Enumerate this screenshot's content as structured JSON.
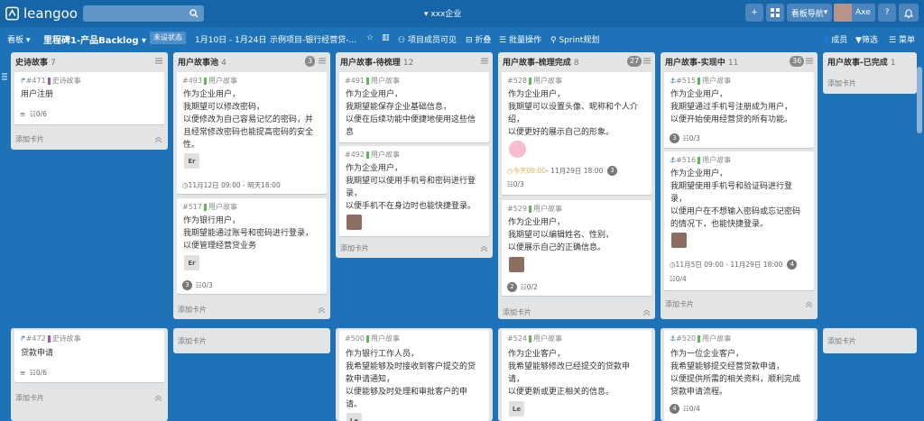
{
  "app": {
    "name": "leangoo"
  },
  "header": {
    "company": "xxx企业",
    "board_nav": "看板导航",
    "user": "Axe",
    "help": "?"
  },
  "subbar": {
    "board": "看板",
    "milestone": "里程碑1-产品Backlog",
    "status": "未设状态",
    "dates": "1月10日 - 1月24日",
    "project": "示例项目-银行经营贷-...",
    "members_visible": "项目成员可见",
    "fold": "折叠",
    "batch": "批量操作",
    "sprint": "Sprint规划",
    "members": "成员",
    "filter": "筛选",
    "menu": "菜单"
  },
  "lists": [
    {
      "title": "史诗故事",
      "count": "7",
      "cards": [
        {
          "id": "#471",
          "type": "史诗故事",
          "lines": [
            "用户注册"
          ],
          "checklist": "0/6"
        },
        {
          "id": "#472",
          "type": "史诗故事",
          "lines": [
            "贷款申请"
          ],
          "checklist": "0/6"
        }
      ],
      "add": "添加卡片"
    },
    {
      "title": "用户故事池",
      "count": "4",
      "badge": "3",
      "cards": [
        {
          "id": "#493",
          "type": "用户故事",
          "lines": [
            "作为企业用户，",
            "我期望可以修改密码，",
            "以便修改为自己容易记忆的密码，并",
            "且经常修改密码也能提高密码的安全",
            "性。"
          ],
          "avatar": "Er",
          "time": "11月12日 09:00 - 明天18:00"
        },
        {
          "id": "#517",
          "type": "用户故事",
          "lines": [
            "作为银行用户，",
            "我期望能通过账号和密码进行登录，",
            "以便管理经营贷业务"
          ],
          "avatar": "Er",
          "comments": "3",
          "checklist": "0/3"
        }
      ],
      "add": "添加卡片",
      "bottom_add": "添加卡片"
    },
    {
      "title": "用户故事-待梳理",
      "count": "12",
      "cards": [
        {
          "id": "#491",
          "type": "用户故事",
          "lines": [
            "作为企业用户，",
            "我期望能保存企业基础信息，",
            "以便在后续功能中便捷地使用这些信",
            "息"
          ]
        },
        {
          "id": "#492",
          "type": "用户故事",
          "lines": [
            "作为企业用户，",
            "我期望可以使用手机号和密码进行登",
            "录，",
            "以便手机不在身边时也能快捷登录。"
          ]
        },
        {
          "id": "#500",
          "type": "用户故事",
          "lines": [
            "作为银行工作人员，",
            "我希望能够及时接收到客户提交的贷",
            "款申请通知，",
            "以便能够及时处理和审批客户的申",
            "请。"
          ],
          "avatar": "Le"
        }
      ],
      "add": "添加卡片"
    },
    {
      "title": "用户故事-梳理完成",
      "count": "8",
      "badge": "27",
      "cards": [
        {
          "id": "#528",
          "type": "用户故事",
          "lines": [
            "作为企业用户，",
            "我期望可以设置头像、昵称和个人介",
            "绍，",
            "以便更好的展示自己的形象。"
          ],
          "time_today": "今天09:00",
          "time_end": " - 11月29日 18:00",
          "comments": "3",
          "checklist": "0/3"
        },
        {
          "id": "#529",
          "type": "用户故事",
          "lines": [
            "作为企业用户，",
            "我期望可以编辑姓名、性别，",
            "以便展示自己的正确信息。"
          ],
          "comments": "2",
          "checklist": "0/2"
        },
        {
          "id": "#524",
          "type": "用户故事",
          "lines": [
            "作为企业客户，",
            "我希望能够修改已经提交的贷款申",
            "请，",
            "以便更新或更正相关的信息。"
          ],
          "avatar": "Le"
        }
      ],
      "add": "添加卡片"
    },
    {
      "title": "用户故事-实现中",
      "count": "11",
      "badge": "36",
      "cards": [
        {
          "id": "#515",
          "type": "用户故事",
          "lines": [
            "作为企业用户，",
            "我期望通过手机号注册成为用户，",
            "以便开始使用经营贷的所有功能。"
          ],
          "comments": "3",
          "checklist": "0/3"
        },
        {
          "id": "#516",
          "type": "用户故事",
          "lines": [
            "作为企业用户，",
            "我期望使用手机号和验证码进行登",
            "录，",
            "以便用户在不想输入密码或忘记密码",
            "的情况下，也能快捷登录。"
          ],
          "time": "11月5日 09:00 - 11月29日 18:00",
          "comments": "4",
          "checklist": "0/4"
        },
        {
          "id": "#520",
          "type": "用户故事",
          "lines": [
            "作为一位企业客户，",
            "我希望能够提交经营贷款申请，",
            "以便提供所需的相关资料，顺利完成",
            "贷款申请流程。"
          ],
          "comments": "4",
          "checklist": "0/4"
        }
      ],
      "add": "添加卡片"
    },
    {
      "title": "用户故事-已完成",
      "count": "1",
      "add": "添加卡片",
      "bottom_add": "添加卡片"
    }
  ]
}
